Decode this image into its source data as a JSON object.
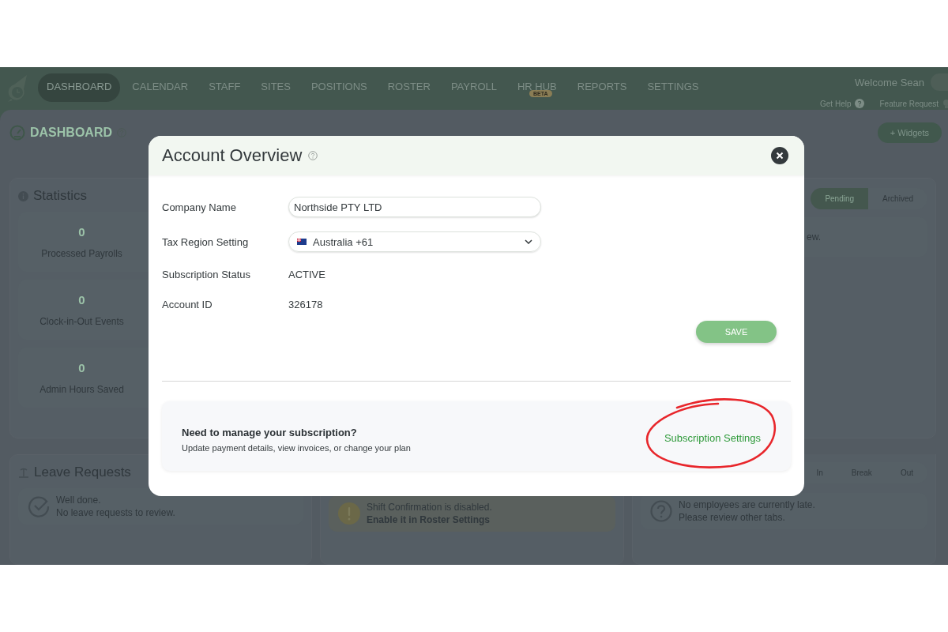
{
  "nav": {
    "items": [
      {
        "label": "DASHBOARD",
        "selected": true
      },
      {
        "label": "CALENDAR",
        "selected": false
      },
      {
        "label": "STAFF",
        "selected": false
      },
      {
        "label": "SITES",
        "selected": false
      },
      {
        "label": "POSITIONS",
        "selected": false
      },
      {
        "label": "ROSTER",
        "selected": false
      },
      {
        "label": "PAYROLL",
        "selected": false
      },
      {
        "label": "HR HUB",
        "selected": false,
        "badge": "BETA"
      },
      {
        "label": "REPORTS",
        "selected": false
      },
      {
        "label": "SETTINGS",
        "selected": false
      }
    ],
    "welcome": "Welcome Sean",
    "help": "Get Help",
    "feature": "Feature Request"
  },
  "dashboard": {
    "title": "DASHBOARD",
    "widgets_button": "+ Widgets"
  },
  "statistics": {
    "title": "Statistics",
    "stats": [
      {
        "value": "0",
        "label": "Processed Payrolls"
      },
      {
        "value": "0",
        "label": "Clock-in-Out Events"
      },
      {
        "value": "0",
        "label": "Admin Hours Saved"
      }
    ]
  },
  "leave_requests": {
    "title": "Leave Requests",
    "message": "Well done.",
    "detail": "No leave requests to review."
  },
  "shift_confirmation": {
    "message": "Shift Confirmation is disabled.",
    "action": "Enable it in Roster Settings"
  },
  "requests_panel": {
    "tabs": [
      {
        "label": "Pending",
        "selected": true
      },
      {
        "label": "Archived",
        "selected": false
      }
    ],
    "column_3": "ew."
  },
  "attendance": {
    "tabs": [
      {
        "label": "In",
        "selected": false
      },
      {
        "label": "Break",
        "selected": false
      },
      {
        "label": "Out",
        "selected": false
      }
    ],
    "message": "No employees are currently late.",
    "detail": "Please review other tabs."
  },
  "modal": {
    "title": "Account Overview",
    "fields": [
      {
        "kind": "input",
        "label": "Company Name",
        "value": "Northside PTY LTD"
      },
      {
        "kind": "select",
        "label": "Tax Region Setting",
        "value": "Australia +61"
      },
      {
        "kind": "text",
        "label": "Subscription Status",
        "value": "ACTIVE"
      },
      {
        "kind": "text",
        "label": "Account ID",
        "value": "326178"
      }
    ],
    "save": "SAVE",
    "subscription": {
      "title": "Need to manage your subscription?",
      "text": "Update payment details, view invoices, or change your plan",
      "link": "Subscription Settings"
    }
  }
}
